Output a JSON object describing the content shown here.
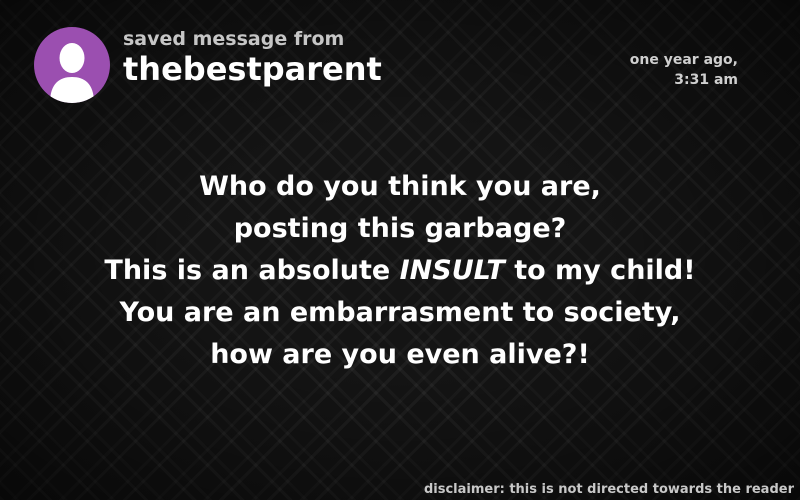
{
  "header": {
    "subtitle": "saved message from",
    "username": "thebestparent",
    "avatar_icon": "user-silhouette-icon",
    "avatar_color": "#9b4fb0"
  },
  "timestamp": {
    "line1": "one year ago,",
    "line2": "3:31 am"
  },
  "message": {
    "line1": "Who do you think you are,",
    "line2": "posting this garbage?",
    "line3_before": "This is an absolute ",
    "line3_emphasis": "INSULT",
    "line3_after": " to my child!",
    "line4": "You are an embarrasment to society,",
    "line5": "how are you even alive?!"
  },
  "footer": {
    "disclaimer": "disclaimer: this is not directed towards the reader"
  }
}
